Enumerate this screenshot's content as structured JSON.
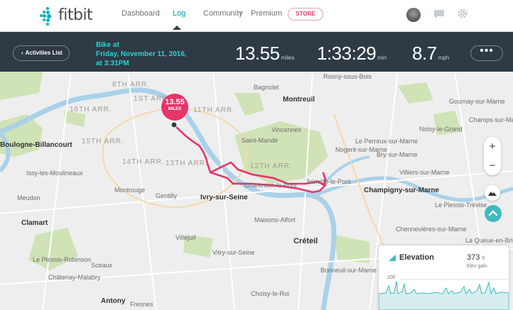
{
  "nav": {
    "brand": "fitbit",
    "links": [
      "Dashboard",
      "Log",
      "Community",
      "Premium"
    ],
    "store_label": "STORE"
  },
  "activity": {
    "back_label": "Activities List",
    "title_line1": "Bike at",
    "title_line2": "Friday, November 11, 2016,",
    "title_line3": "at 3:31PM",
    "distance": "13.55",
    "distance_unit": "miles",
    "duration": "1:33:29",
    "duration_unit": "min",
    "speed": "8.7",
    "speed_unit": "mph",
    "more_label": "•••"
  },
  "map": {
    "badge_value": "13.55",
    "badge_unit": "MILES",
    "labels": {
      "arr8": "8TH ARR.",
      "arr1": "1ST ARR.",
      "arr16": "16TH ARR.",
      "arr15": "15TH ARR.",
      "arr14": "14TH ARR.",
      "arr13": "13TH ARR.",
      "arr11": "11TH ARR.",
      "arr12": "12TH ARR.",
      "bagnolet": "Bagnolet",
      "montreuil": "Montreuil",
      "rosny": "Rosny-sous-Bois",
      "boulogne": "Boulogne-Billancourt",
      "issy": "Issy-les-Moulineaux",
      "meudon": "Meudon",
      "montrouge": "Montrouge",
      "gentilly": "Gentilly",
      "ivry": "Ivry-sur-Seine",
      "charenton": "Charenton-le-Pont",
      "joinville": "Joinville-le-Pont",
      "champigny": "Champigny-sur-Marne",
      "vincennes": "Vincennes",
      "saintmande": "Saint-Mandé",
      "nogent": "Nogent-sur-Marne",
      "perreux": "Le Perreux-sur-Marne",
      "bry": "Bry-sur-Marne",
      "villiers": "Villiers-sur-Marne",
      "noisy": "Noisy-le-Grand",
      "gournay": "Gournay-sur-Marne",
      "champs": "Champs-sur-Marne",
      "maisons": "Maisons-Alfort",
      "creteil": "Créteil",
      "villejuif": "Villejuif",
      "vitry": "Vitry-sur-Seine",
      "clamart": "Clamart",
      "plessisr": "Le Plessis-Robinson",
      "chatenay": "Châtenay-Malabry",
      "sceaux": "Sceaux",
      "antony": "Antony",
      "fresnes": "Fresnes",
      "choisy": "Choisy-le-Roi",
      "bonneuil": "Bonneuil-sur-Marne",
      "chennevieres": "Chennevières-sur-Marne",
      "plessist": "Le Plessis-Trévise",
      "queue": "La Queue-en-Brie"
    }
  },
  "elevation": {
    "title": "Elevation",
    "value": "373",
    "unit": "ft",
    "sub": "Elev gain",
    "tick": "200"
  },
  "colors": {
    "accent": "#00b0b9",
    "route": "#e8336b",
    "bar": "#2e3a44"
  }
}
